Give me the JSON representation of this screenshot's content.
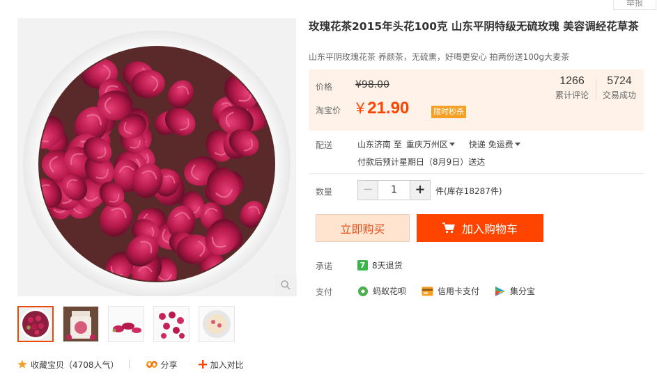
{
  "report_label": "举报",
  "product": {
    "title": "玫瑰花茶2015年头花100克 山东平阴特级无硫玫瑰 美容调经花草茶",
    "subtitle": "山东平阴玫瑰花茶 养颜茶，无硫熏，好喝更安心 拍两份送100g大麦茶"
  },
  "price": {
    "label": "价格",
    "original": "¥98.00",
    "promo_label": "淘宝价",
    "currency": "¥",
    "current": "21.90",
    "tag": "限时秒杀"
  },
  "stats": [
    {
      "value": "1266",
      "label": "累计评论"
    },
    {
      "value": "5724",
      "label": "交易成功"
    }
  ],
  "shipping": {
    "label": "配送",
    "from": "山东济南 至",
    "to": "重庆万州区",
    "method": "快递 免运费",
    "eta": "付款后预计星期日（8月9日）送达"
  },
  "quantity": {
    "label": "数量",
    "minus": "−",
    "value": "1",
    "plus": "+",
    "stock": "件(库存18287件)"
  },
  "buttons": {
    "buy_now": "立即购买",
    "add_to_cart": "加入购物车"
  },
  "promise": {
    "label": "承诺",
    "badge": "7",
    "text": "8天退货"
  },
  "payment": {
    "label": "支付",
    "methods": [
      {
        "name": "蚂蚁花呗",
        "icon": "huabei-icon"
      },
      {
        "name": "信用卡支付",
        "icon": "credit-card-icon"
      },
      {
        "name": "集分宝",
        "icon": "jifenbao-icon"
      }
    ]
  },
  "actions": {
    "favorite": "收藏宝贝（4708人气）",
    "share": "分享",
    "compare": "加入对比"
  },
  "colors": {
    "accent": "#ff4400",
    "price": "#ff4400",
    "tag": "#f7a026",
    "price_bg": "#fff3e9"
  }
}
